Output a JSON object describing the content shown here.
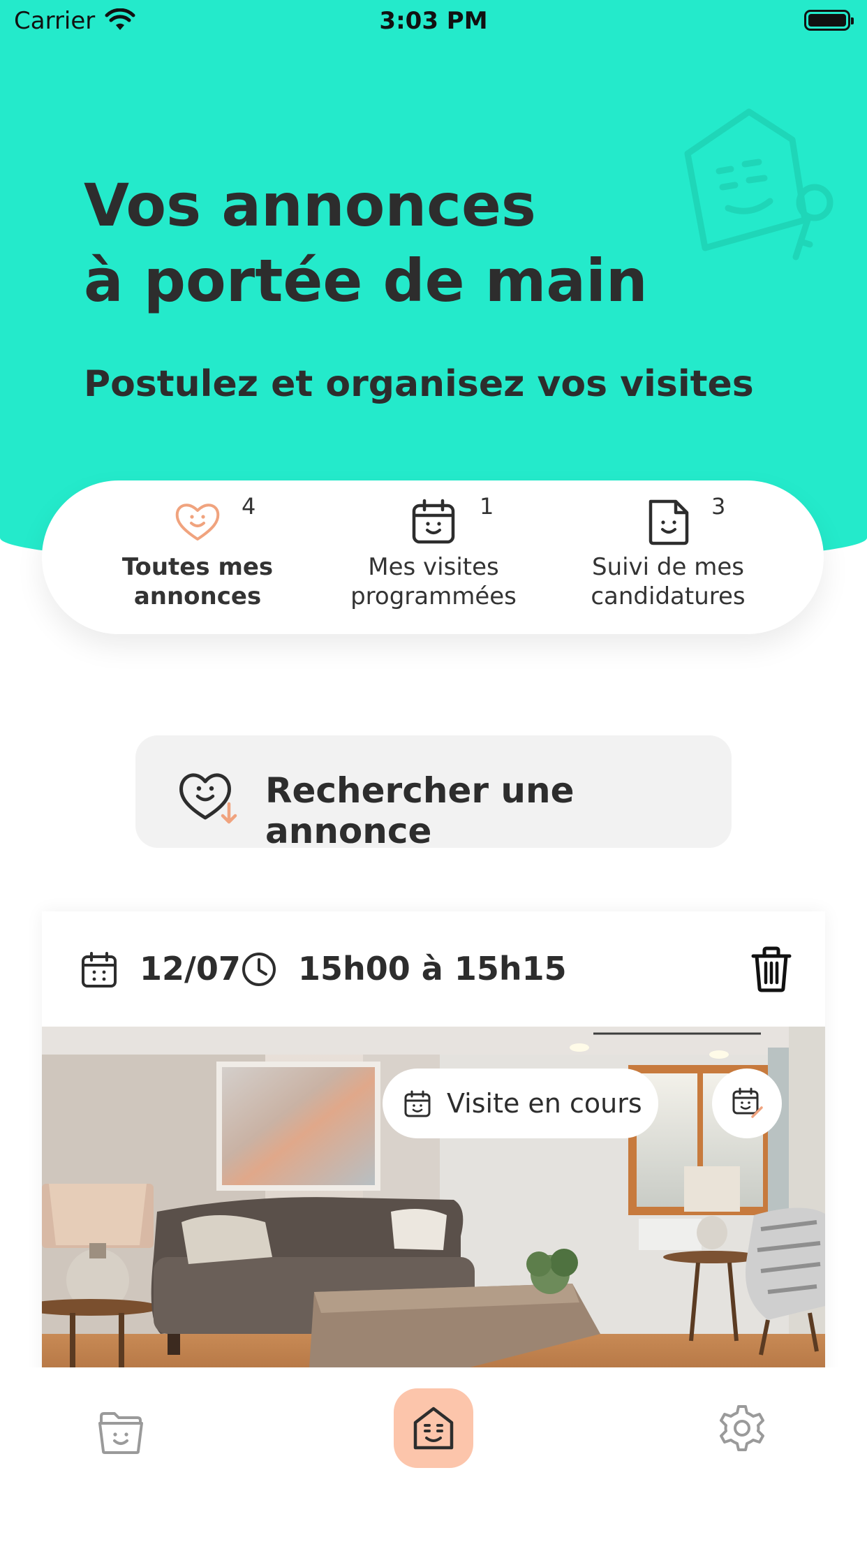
{
  "status_bar": {
    "carrier": "Carrier",
    "time": "3:03 PM"
  },
  "hero": {
    "title_line1": "Vos annonces",
    "title_line2": "à portée de main",
    "subtitle": "Postulez et organisez vos visites"
  },
  "tabs": [
    {
      "label": "Toutes mes\nannonces",
      "count": "4",
      "icon": "heart-smile-icon",
      "active": true
    },
    {
      "label": "Mes visites\nprogrammées",
      "count": "1",
      "icon": "calendar-smile-icon",
      "active": false
    },
    {
      "label": "Suivi de mes\ncandidatures",
      "count": "3",
      "icon": "document-smile-icon",
      "active": false
    }
  ],
  "search": {
    "label": "Rechercher une annonce",
    "icon": "heart-download-icon"
  },
  "visit_card": {
    "date": "12/07",
    "time": "15h00 à 15h15",
    "status": "Visite en cours",
    "photo": "living-room-photo"
  },
  "bottom_nav": [
    {
      "icon": "folder-smile-icon"
    },
    {
      "icon": "home-smile-icon",
      "active": true
    },
    {
      "icon": "gear-icon"
    }
  ],
  "colors": {
    "hero": "#24eacb",
    "accent_orange": "#f0a37e",
    "nav_active_bg": "#fcc5ab",
    "text_dark": "#2d2d2d"
  }
}
